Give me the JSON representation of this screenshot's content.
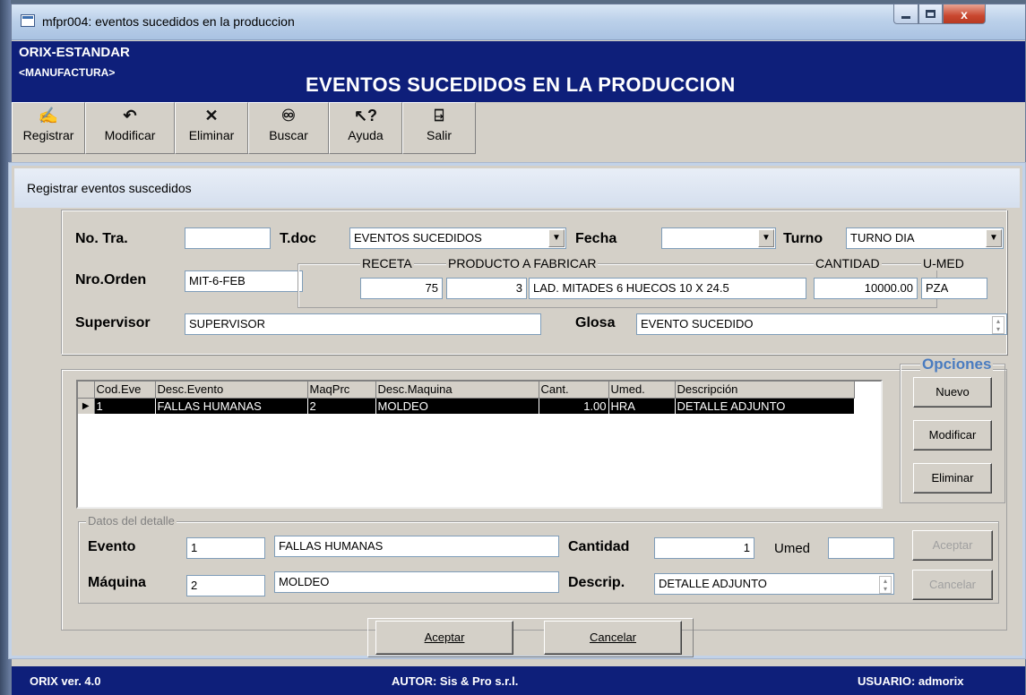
{
  "window": {
    "title": "mfpr004: eventos sucedidos en la produccion",
    "close_glyph": "x"
  },
  "header": {
    "company": "ORIX-ESTANDAR",
    "module": "<MANUFACTURA>",
    "title": "EVENTOS SUCEDIDOS EN LA PRODUCCION"
  },
  "toolbar": {
    "buttons": [
      {
        "label": "Registrar",
        "icon": "register-icon",
        "glyph": "✍"
      },
      {
        "label": "Modificar",
        "icon": "undo-icon",
        "glyph": "↶"
      },
      {
        "label": "Eliminar",
        "icon": "delete-x-icon",
        "glyph": "✕"
      },
      {
        "label": "Buscar",
        "icon": "binoculars-icon",
        "glyph": "♾"
      },
      {
        "label": "Ayuda",
        "icon": "help-pointer-icon",
        "glyph": "↖?"
      },
      {
        "label": "Salir",
        "icon": "exit-door-icon",
        "glyph": "⍈"
      }
    ]
  },
  "panel": {
    "title": "Registrar eventos suscedidos"
  },
  "form": {
    "no_tra_label": "No. Tra.",
    "no_tra_value": "",
    "tdoc_label": "T.doc",
    "tdoc_value": "EVENTOS SUCEDIDOS",
    "fecha_label": "Fecha",
    "fecha_value": "",
    "turno_label": "Turno",
    "turno_value": "TURNO DIA",
    "nro_orden_label": "Nro.Orden",
    "nro_orden_value": "MIT-6-FEB",
    "receta_label": "RECETA",
    "receta_value": "75",
    "producto_label": "PRODUCTO A FABRICAR",
    "producto_code": "3",
    "producto_desc": "LAD. MITADES 6 HUECOS 10 X 24.5",
    "cantidad_label": "CANTIDAD",
    "cantidad_value": "10000.00",
    "umed_label": "U-MED",
    "umed_value": "PZA",
    "supervisor_label": "Supervisor",
    "supervisor_value": "SUPERVISOR",
    "glosa_label": "Glosa",
    "glosa_value": "EVENTO SUCEDIDO"
  },
  "grid": {
    "columns": [
      "Cod.Eve",
      "Desc.Evento",
      "MaqPrc",
      "Desc.Maquina",
      "Cant.",
      "Umed.",
      "Descripción"
    ],
    "rows": [
      {
        "cod_eve": "1",
        "desc_evento": "FALLAS HUMANAS",
        "maqprc": "2",
        "desc_maquina": "MOLDEO",
        "cant": "1.00",
        "umed": "HRA",
        "descripcion": "DETALLE ADJUNTO"
      }
    ],
    "row_indicator": "▶"
  },
  "opciones": {
    "legend": "Opciones",
    "nuevo": "Nuevo",
    "modificar": "Modificar",
    "eliminar": "Eliminar"
  },
  "detalle": {
    "legend": "Datos del detalle",
    "evento_label": "Evento",
    "evento_code": "1",
    "evento_desc": "FALLAS HUMANAS",
    "maquina_label": "Máquina",
    "maquina_code": "2",
    "maquina_desc": "MOLDEO",
    "cantidad_label": "Cantidad",
    "cantidad_value": "1",
    "umed_label": "Umed",
    "umed_value": "",
    "descrip_label": "Descrip.",
    "descrip_value": "DETALLE ADJUNTO",
    "aceptar": "Aceptar",
    "cancelar": "Cancelar"
  },
  "footer_buttons": {
    "aceptar": "Aceptar",
    "cancelar": "Cancelar"
  },
  "statusbar": {
    "version": "ORIX ver. 4.0",
    "author": "AUTOR: Sis & Pro s.r.l.",
    "user": "USUARIO: admorix"
  },
  "colors": {
    "header_bg": "#0e1f7a",
    "window_bg": "#d4d0c8",
    "opciones_legend": "#4a7cc0"
  }
}
